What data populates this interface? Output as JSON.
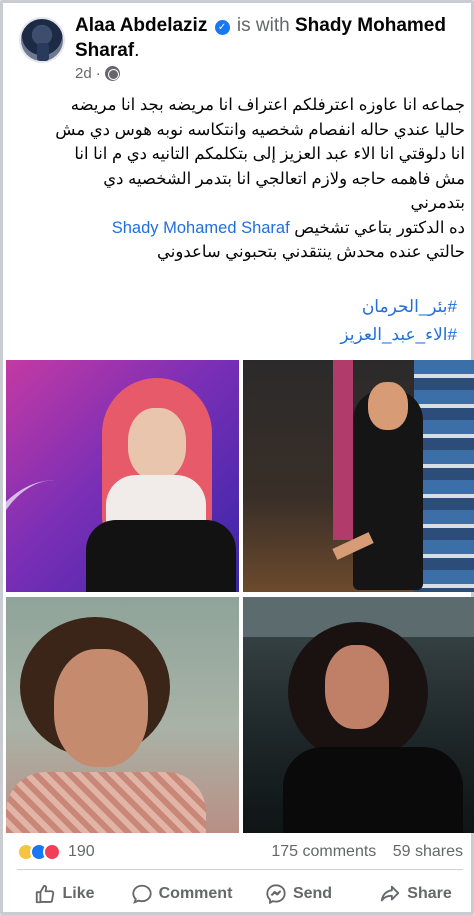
{
  "post": {
    "author": "Alaa Abdelaziz",
    "is_with": "is with",
    "tagged": "Shady Mohamed Sharaf",
    "period": ".",
    "time": "2d",
    "privacy_icon": "globe-icon",
    "text_lines": [
      "جماعه انا عاوزه اعترفلكم اعتراف انا مريضه بجد انا مريضه",
      "حاليا عندي حاله انفصام شخصيه وانتكاسه نوبه هوس دي مش",
      "انا دلوقتي انا الاء عبد العزيز إلى بتكلمكم التانيه دي م انا انا",
      "مش فاهمه حاجه ولازم اتعالجي انا بتدمر الشخصيه دي",
      "بتدمرني"
    ],
    "doctor_line_prefix": "ده الدكتور بتاعي تشخيص",
    "doctor_tag": "Shady Mohamed Sharaf",
    "closing_line": "حالتي عنده محدش ينتقدني بتحبوني ساعدوني",
    "hashtags": [
      "#بئر_الحرمان",
      "#الاء_عبد_العزيز"
    ]
  },
  "stats": {
    "reaction_icons": [
      "sad-reaction-icon",
      "like-reaction-icon",
      "love-reaction-icon"
    ],
    "reaction_count": "190",
    "comments": "175 comments",
    "shares": "59 shares"
  },
  "actions": {
    "like": "Like",
    "comment": "Comment",
    "send": "Send",
    "share": "Share"
  },
  "colors": {
    "link": "#216fdb",
    "verified": "#1877f2",
    "muted": "#65676b"
  }
}
